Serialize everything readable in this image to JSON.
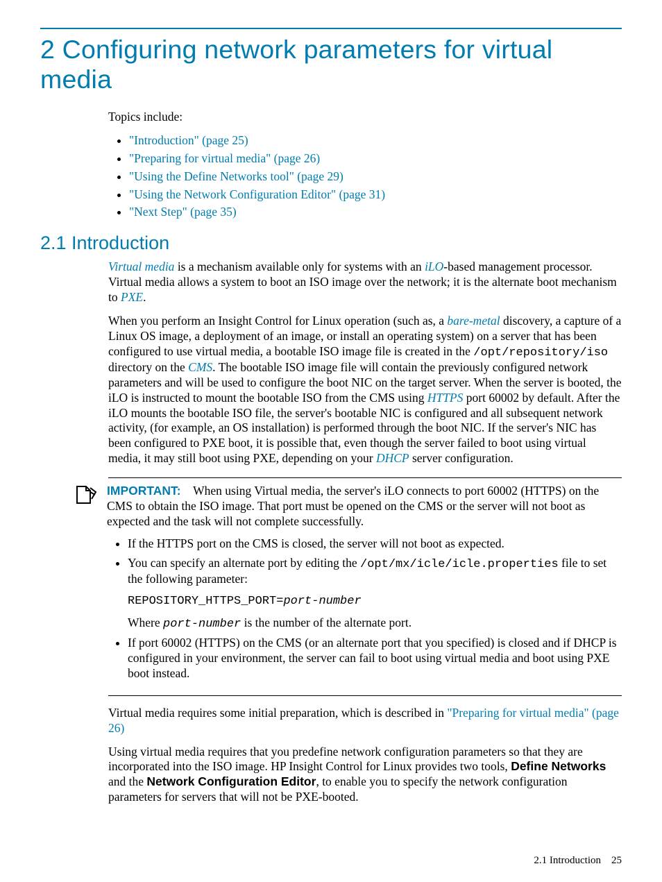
{
  "chapter": {
    "title": "2 Configuring network parameters for virtual media"
  },
  "topics_intro": "Topics include:",
  "topics": [
    "\"Introduction\" (page 25)",
    "\"Preparing for virtual media\" (page 26)",
    "\"Using the Define Networks tool\" (page 29)",
    "\"Using the Network Configuration Editor\" (page 31)",
    "\"Next Step\" (page 35)"
  ],
  "section": {
    "number_title": "2.1 Introduction"
  },
  "para1": {
    "virtual_media": "Virtual media",
    "seg1": " is a mechanism available only for systems with an ",
    "ilo": "iLO",
    "seg2": "-based management processor. Virtual media allows a system to boot an ISO image over the network; it is the alternate boot mechanism to ",
    "pxe": "PXE",
    "seg3": "."
  },
  "para2": {
    "seg1": "When you perform an Insight Control for Linux operation (such as, a ",
    "bare_metal": "bare-metal",
    "seg2": " discovery, a capture of a Linux OS image, a deployment of an image, or install an operating system) on a server that has been configured to use virtual media, a bootable ISO image file is created in the ",
    "path": "/opt/repository/iso",
    "seg3": " directory on the ",
    "cms": "CMS",
    "seg4": ". The bootable ISO image file will contain the previously configured network parameters and will be used to configure the boot NIC on the target server. When the server is booted, the iLO is instructed to mount the bootable ISO from the CMS using ",
    "https": "HTTPS",
    "seg5": " port 60002 by default. After the iLO mounts the bootable ISO file, the server's bootable NIC is configured and all subsequent network activity, (for example, an OS installation) is performed through the boot NIC. If the server's NIC has been configured to PXE boot, it is possible that, even though the server failed to boot using virtual media, it may still boot using PXE, depending on your ",
    "dhcp": "DHCP",
    "seg6": " server configuration."
  },
  "important": {
    "label": "IMPORTANT:",
    "lead": "When using Virtual media, the server's iLO connects to port 60002 (HTTPS) on the CMS to obtain the ISO image. That port must be opened on the CMS or the server will not boot as expected and the task will not complete successfully.",
    "bullet1": "If the HTTPS port on the CMS is closed, the server will not boot as expected.",
    "bullet2_a": "You can specify an alternate port by editing the ",
    "bullet2_path": "/opt/mx/icle/icle.properties",
    "bullet2_b": " file to set the following parameter:",
    "code_prefix": "REPOSITORY_HTTPS_PORT=",
    "code_var": "port-number",
    "where_a": "Where ",
    "where_var": "port-number",
    "where_b": " is the number of the alternate port.",
    "bullet3": "If port 60002 (HTTPS) on the CMS (or an alternate port that you specified) is closed and if DHCP is configured in your environment, the server can fail to boot using virtual media and boot using PXE boot instead."
  },
  "after1": {
    "seg1": "Virtual media requires some initial preparation, which is described in ",
    "link": "\"Preparing for virtual media\" (page 26)"
  },
  "after2": {
    "seg1": "Using virtual media requires that you predefine network configuration parameters so that they are incorporated into the ISO image. HP Insight Control for Linux provides two tools, ",
    "bold1": "Define Networks",
    "seg2": " and the ",
    "bold2": "Network Configuration Editor",
    "seg3": ", to enable you to specify the network configuration parameters for servers that will not be PXE-booted."
  },
  "footer": {
    "text": "2.1 Introduction",
    "page": "25"
  }
}
